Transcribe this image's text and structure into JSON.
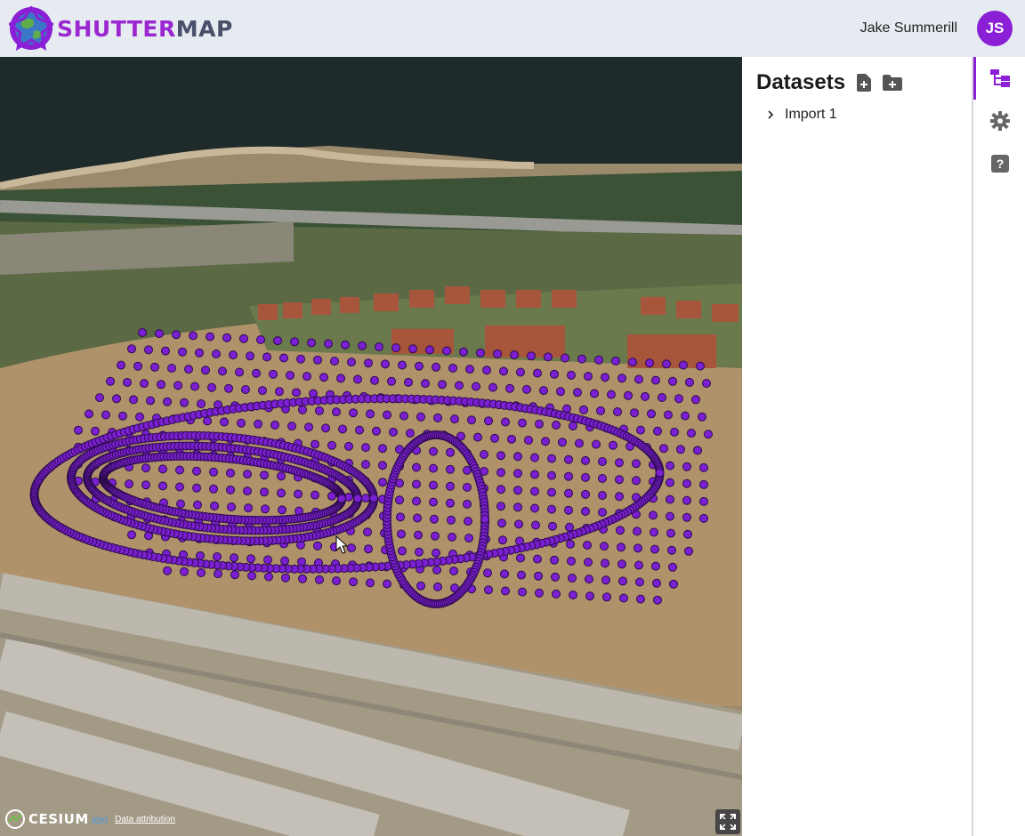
{
  "app": {
    "brand_part1": "SHUTTER",
    "brand_part2": "MAP",
    "user_name": "Jake Summerill",
    "user_initials": "JS",
    "accent_color": "#8a1fd6"
  },
  "panel": {
    "title": "Datasets",
    "add_file_icon": "file-plus-icon",
    "add_folder_icon": "folder-plus-icon",
    "items": [
      {
        "label": "Import 1",
        "expanded": false
      }
    ]
  },
  "rail": {
    "items": [
      {
        "icon": "tree-icon",
        "active": true
      },
      {
        "icon": "gear-icon",
        "active": false
      },
      {
        "icon": "help-icon",
        "active": false
      }
    ]
  },
  "map": {
    "credit_logo": "CESIUM",
    "credit_ion": "ion",
    "attribution": "Data attribution",
    "marker_color": "#7a1fd1"
  }
}
